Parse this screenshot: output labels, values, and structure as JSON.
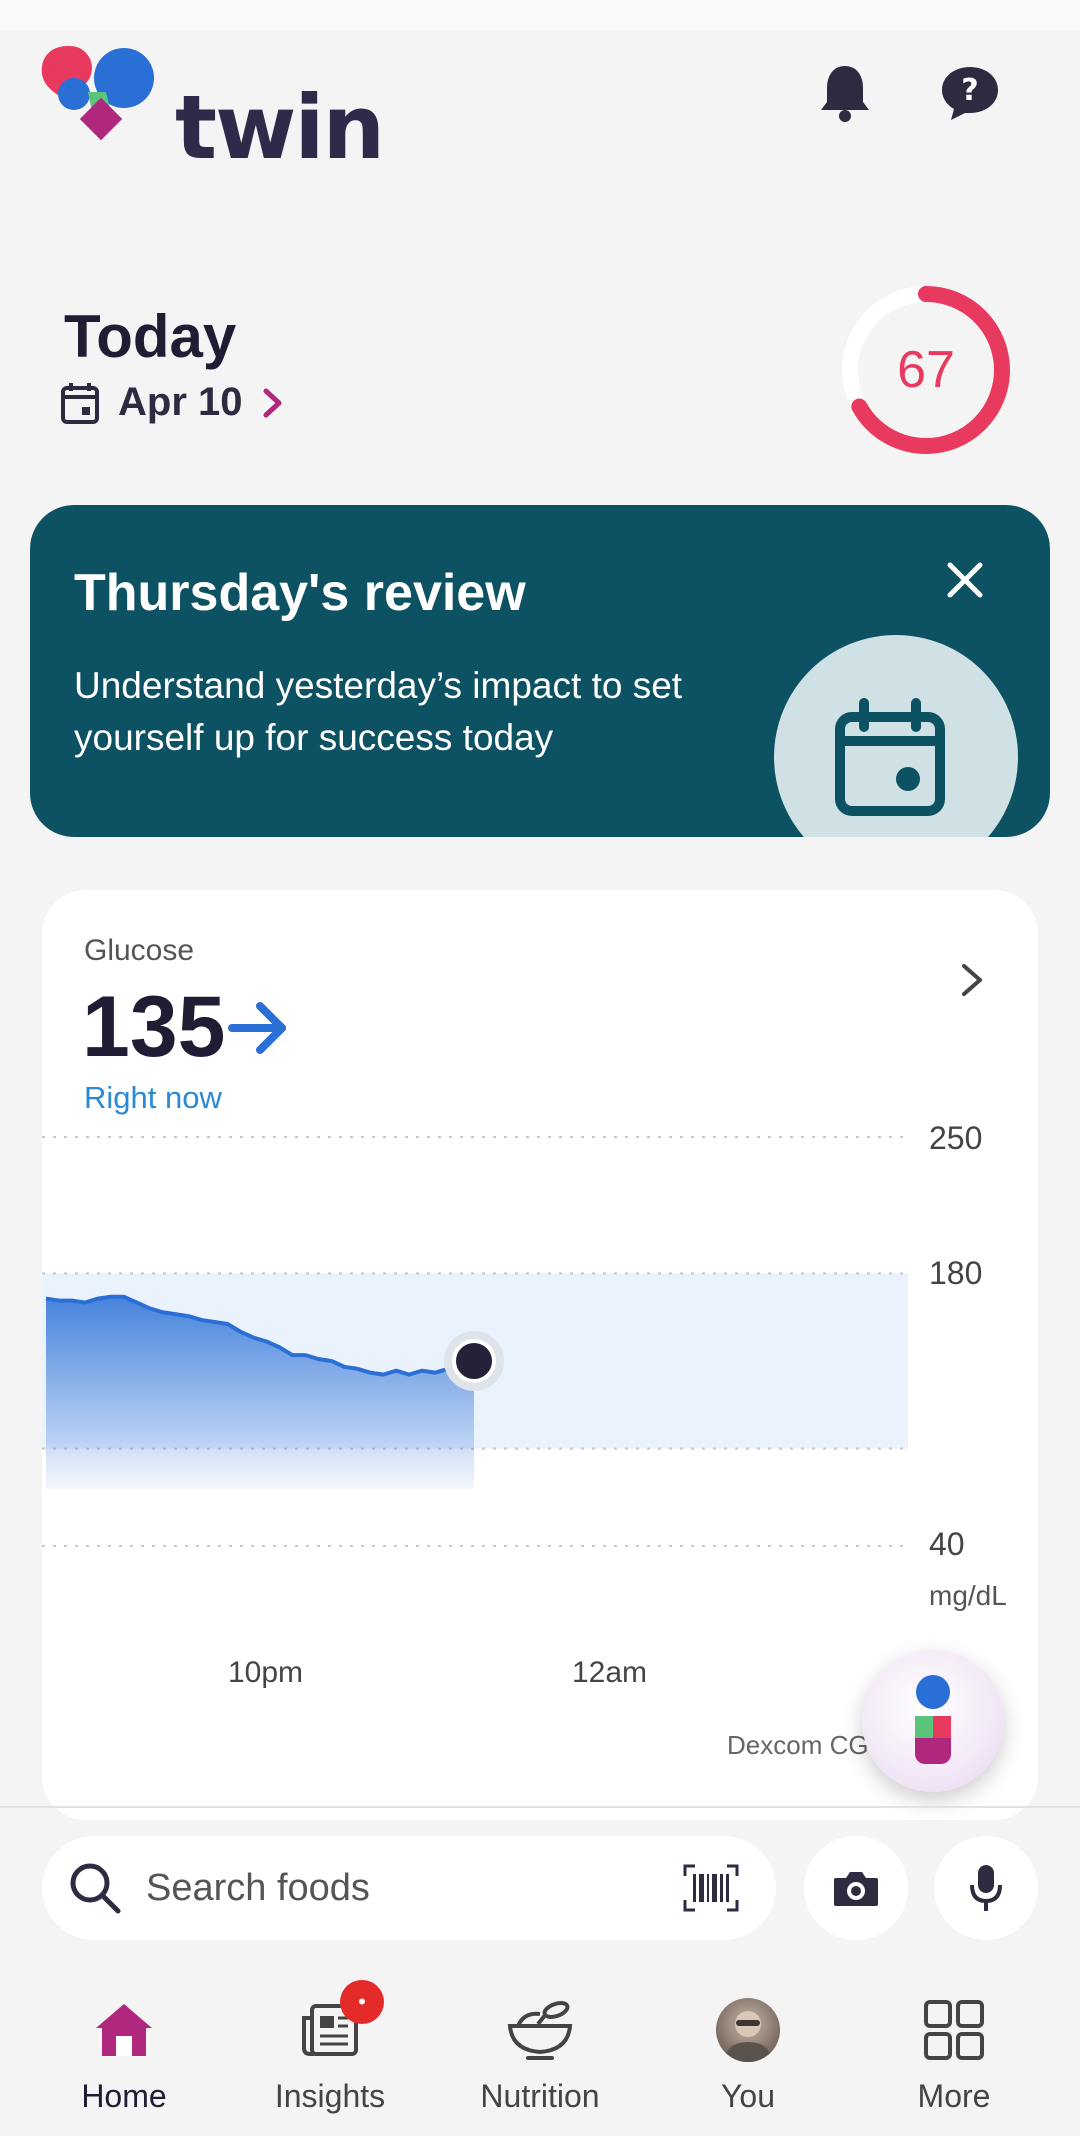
{
  "app": {
    "name": "twin"
  },
  "header": {
    "notifications_icon": "bell-icon",
    "help_icon": "question-bubble-icon"
  },
  "today": {
    "title": "Today",
    "date": "Apr 10",
    "score": "67",
    "score_fraction": 0.67,
    "score_color": "#e8395f"
  },
  "review_card": {
    "title": "Thursday's review",
    "body": "Understand yesterday’s impact to set yourself up for success today",
    "bg_color": "#0d5263"
  },
  "glucose_card": {
    "label": "Glucose",
    "value": "135",
    "trend_icon": "arrow-right-icon",
    "subtitle": "Right now",
    "source": "Dexcom CG",
    "y_ticks": [
      "250",
      "180",
      "40"
    ],
    "unit": "mg/dL",
    "x_ticks": [
      "10pm",
      "12am"
    ]
  },
  "chart_data": {
    "type": "area",
    "title": "Glucose",
    "xlabel": "",
    "ylabel": "mg/dL",
    "ylim": [
      40,
      250
    ],
    "x_ticks": [
      "10pm",
      "12am"
    ],
    "target_range": [
      90,
      180
    ],
    "gridlines": [
      250,
      180,
      90,
      40
    ],
    "series": [
      {
        "values": [
          167,
          166,
          166,
          165,
          167,
          168,
          168,
          165,
          162,
          160,
          159,
          158,
          156,
          155,
          154,
          150,
          147,
          145,
          142,
          138,
          138,
          136,
          135,
          132,
          131,
          129,
          128,
          130,
          128,
          130,
          129,
          131,
          134,
          135
        ]
      }
    ],
    "current": {
      "value": 135,
      "label": "Right now"
    }
  },
  "search": {
    "placeholder": "Search foods",
    "barcode_icon": "barcode-icon",
    "camera_icon": "camera-icon",
    "mic_icon": "microphone-icon"
  },
  "nav": {
    "items": [
      {
        "label": "Home",
        "icon": "home-icon",
        "active": true
      },
      {
        "label": "Insights",
        "icon": "news-icon",
        "badge": "•"
      },
      {
        "label": "Nutrition",
        "icon": "bowl-icon"
      },
      {
        "label": "You",
        "icon": "avatar"
      },
      {
        "label": "More",
        "icon": "grid-icon"
      }
    ]
  },
  "colors": {
    "brand": "#2e2a4a",
    "accent_blue": "#2a6fd6",
    "active_nav": "#b0287e"
  }
}
